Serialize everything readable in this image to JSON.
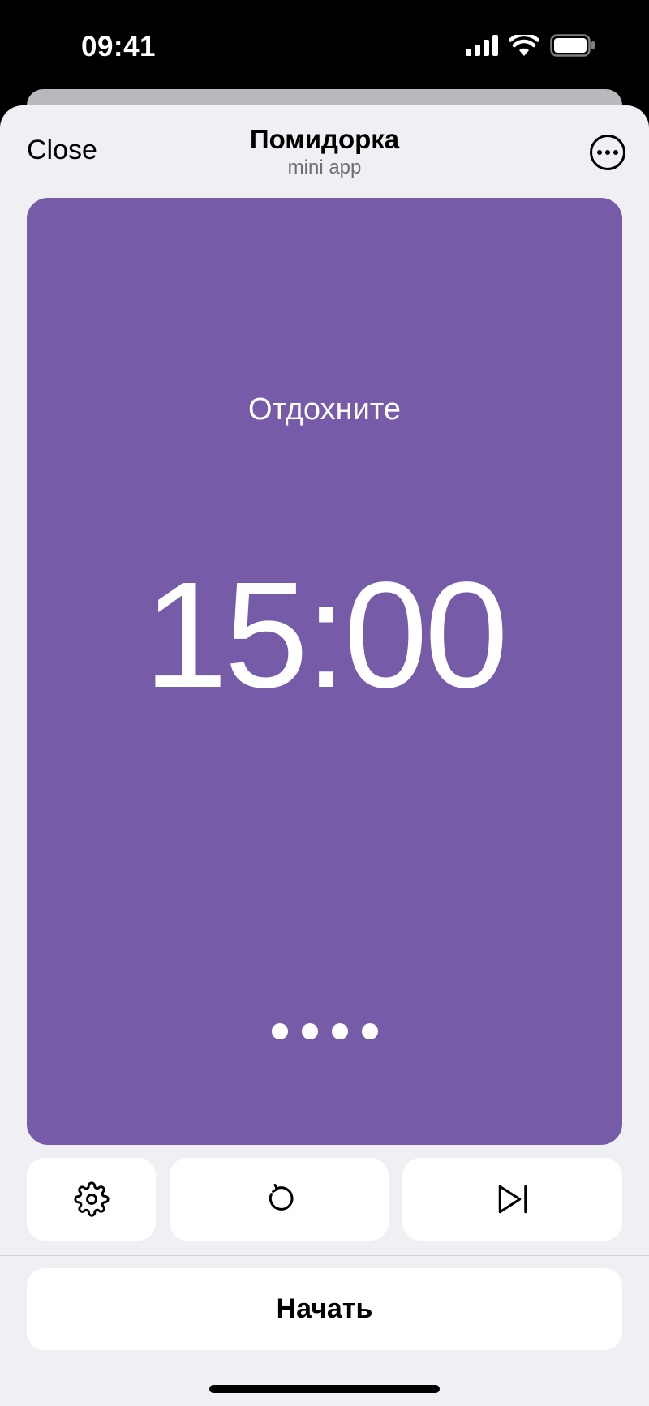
{
  "status_bar": {
    "time": "09:41",
    "icons": [
      "signal-icon",
      "wifi-icon",
      "battery-icon"
    ]
  },
  "header": {
    "close_label": "Close",
    "title": "Помидорка",
    "subtitle": "mini app",
    "more_icon": "more-icon"
  },
  "timer": {
    "status_text": "Отдохните",
    "time": "15:00",
    "session_dots": 4
  },
  "controls": {
    "settings_icon": "gear-icon",
    "reset_icon": "reset-icon",
    "skip_icon": "skip-next-icon"
  },
  "main_button": {
    "label": "Начать"
  },
  "colors": {
    "timer_background": "#755ba8",
    "sheet_background": "#efeff4",
    "button_background": "#ffffff"
  }
}
